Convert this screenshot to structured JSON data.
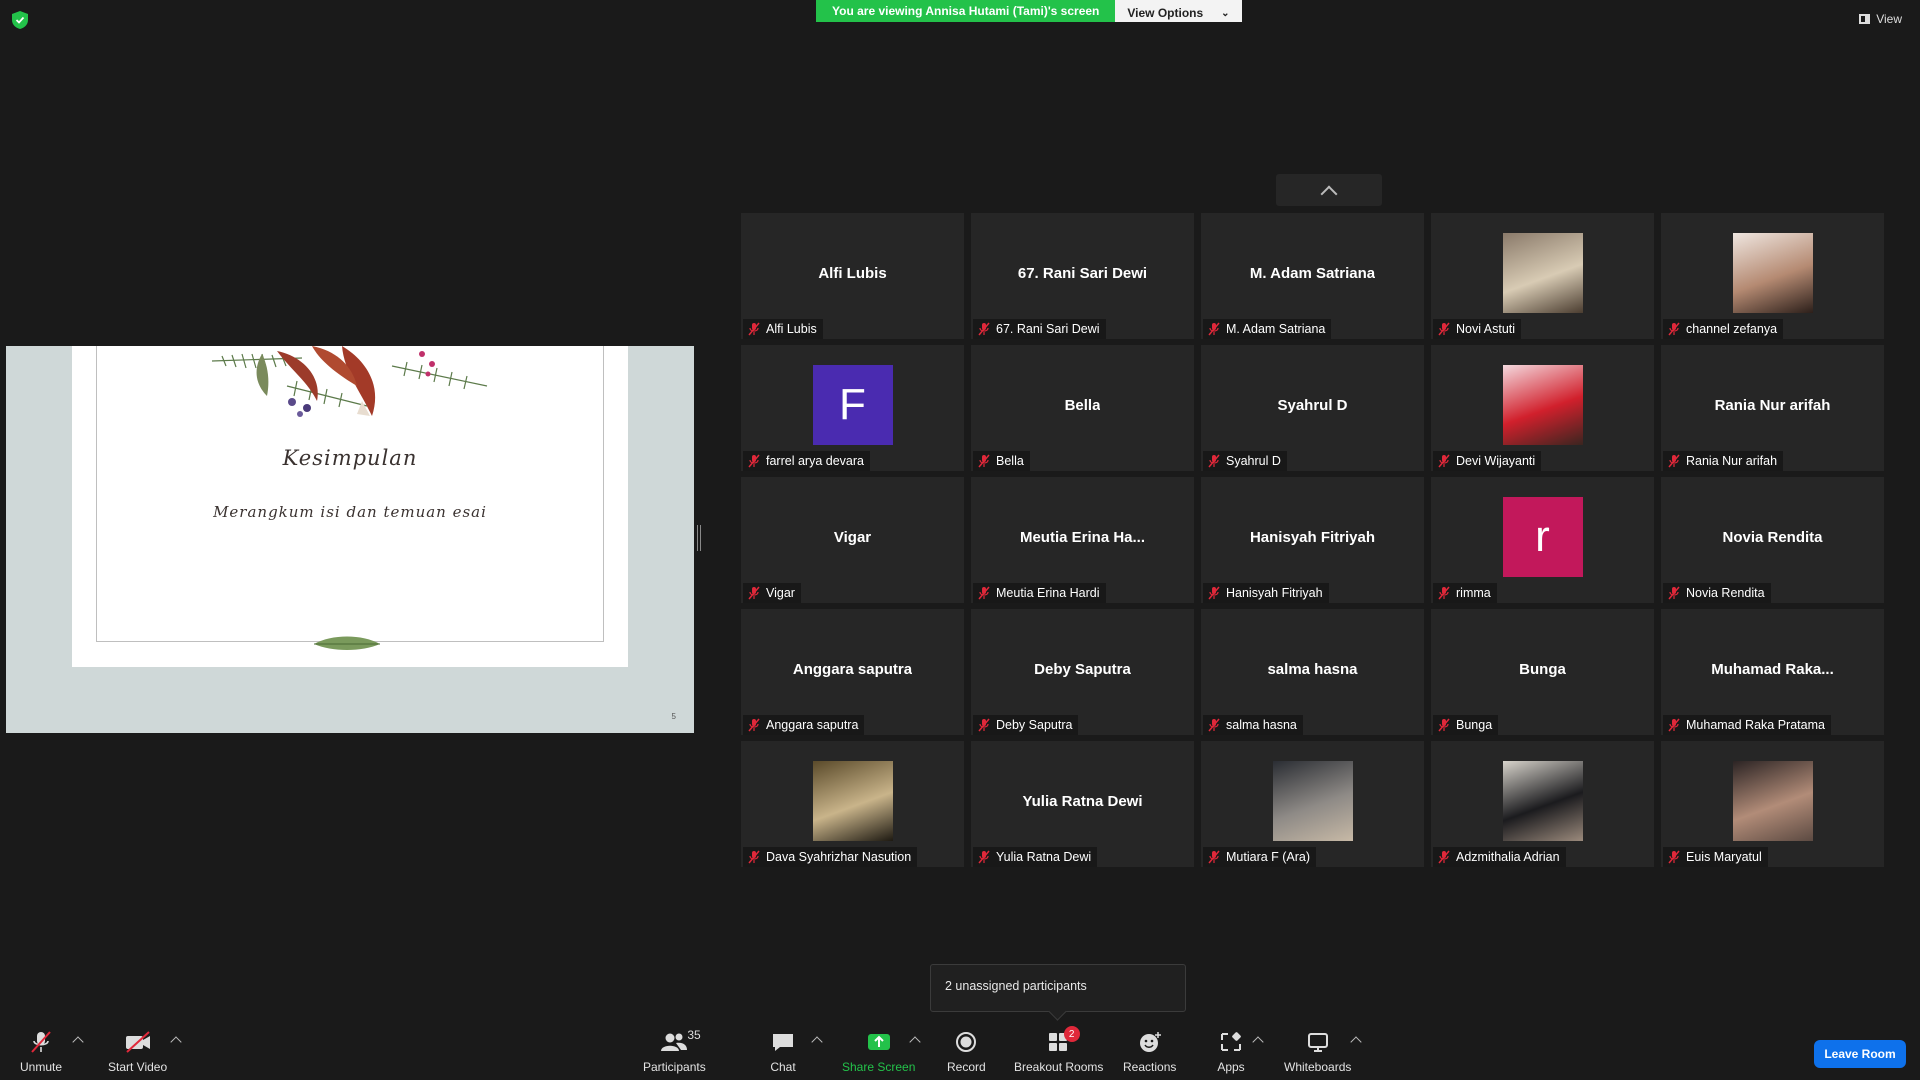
{
  "banner": {
    "viewing_text": "You are viewing Annisa Hutami (Tami)'s screen",
    "view_options_label": "View Options",
    "view_label": "View"
  },
  "slide": {
    "title": "Kesimpulan",
    "subtitle": "Merangkum isi dan temuan esai",
    "page_number": "5"
  },
  "participants": [
    {
      "big": "Alfi Lubis",
      "label": "Alfi Lubis",
      "avatar": "none"
    },
    {
      "big": "67. Rani Sari Dewi",
      "label": "67. Rani Sari Dewi",
      "avatar": "none"
    },
    {
      "big": "M. Adam Satriana",
      "label": "M. Adam Satriana",
      "avatar": "none"
    },
    {
      "big": "",
      "label": "Novi Astuti",
      "avatar": "photo",
      "photo_colors": [
        "#8a7a6a",
        "#d8cbb4",
        "#4b3d30"
      ]
    },
    {
      "big": "",
      "label": "channel zefanya",
      "avatar": "photo",
      "photo_colors": [
        "#efe6e0",
        "#b58a72",
        "#2c1f1a"
      ]
    },
    {
      "big": "F",
      "label": "farrel arya devara",
      "avatar": "letter",
      "letter_color": "#4a2bb0"
    },
    {
      "big": "Bella",
      "label": "Bella",
      "avatar": "none"
    },
    {
      "big": "Syahrul D",
      "label": "Syahrul D",
      "avatar": "none"
    },
    {
      "big": "",
      "label": "Devi Wijayanti",
      "avatar": "photo",
      "photo_colors": [
        "#f4d9de",
        "#d1202c",
        "#3a2520"
      ]
    },
    {
      "big": "Rania Nur arifah",
      "label": "Rania Nur arifah",
      "avatar": "none"
    },
    {
      "big": "Vigar",
      "label": "Vigar",
      "avatar": "none"
    },
    {
      "big": "Meutia  Erina  Ha...",
      "label": "Meutia Erina Hardi",
      "avatar": "none"
    },
    {
      "big": "Hanisyah Fitriyah",
      "label": "Hanisyah Fitriyah",
      "avatar": "none"
    },
    {
      "big": "r",
      "label": "rimma",
      "avatar": "letter",
      "letter_color": "#c2185b"
    },
    {
      "big": "Novia Rendita",
      "label": "Novia Rendita",
      "avatar": "none"
    },
    {
      "big": "Anggara saputra",
      "label": "Anggara saputra",
      "avatar": "none"
    },
    {
      "big": "Deby Saputra",
      "label": "Deby Saputra",
      "avatar": "none"
    },
    {
      "big": "salma hasna",
      "label": "salma hasna",
      "avatar": "none"
    },
    {
      "big": "Bunga",
      "label": "Bunga",
      "avatar": "none"
    },
    {
      "big": "Muhamad  Raka...",
      "label": "Muhamad Raka Pratama",
      "avatar": "none"
    },
    {
      "big": "",
      "label": "Dava Syahrizhar Nasution",
      "avatar": "photo",
      "photo_colors": [
        "#5a4a2a",
        "#c9b48a",
        "#1e1a12"
      ]
    },
    {
      "big": "Yulia Ratna Dewi",
      "label": "Yulia Ratna Dewi",
      "avatar": "none"
    },
    {
      "big": "",
      "label": "Mutiara F (Ara)",
      "avatar": "photo",
      "photo_colors": [
        "#2a2d33",
        "#8e8a86",
        "#c7b9a6"
      ]
    },
    {
      "big": "",
      "label": "Adzmithalia Adrian",
      "avatar": "photo",
      "photo_colors": [
        "#d8d4cc",
        "#1b1b1e",
        "#9b8a7c"
      ]
    },
    {
      "big": "",
      "label": "Euis Maryatul",
      "avatar": "photo",
      "photo_colors": [
        "#2c2424",
        "#b28c78",
        "#5c4a42"
      ]
    }
  ],
  "tooltip": {
    "text": "2 unassigned participants"
  },
  "toolbar": {
    "unmute": "Unmute",
    "start_video": "Start Video",
    "participants": "Participants",
    "participants_count": "35",
    "chat": "Chat",
    "share_screen": "Share Screen",
    "record": "Record",
    "breakout_rooms": "Breakout Rooms",
    "breakout_badge": "2",
    "reactions": "Reactions",
    "apps": "Apps",
    "whiteboards": "Whiteboards",
    "leave_room": "Leave Room"
  },
  "colors": {
    "share_green": "#23c24a",
    "leave_blue": "#0e71eb",
    "badge_red": "#e0283a",
    "tile_bg": "#262626",
    "mute_red": "#e0283a"
  }
}
